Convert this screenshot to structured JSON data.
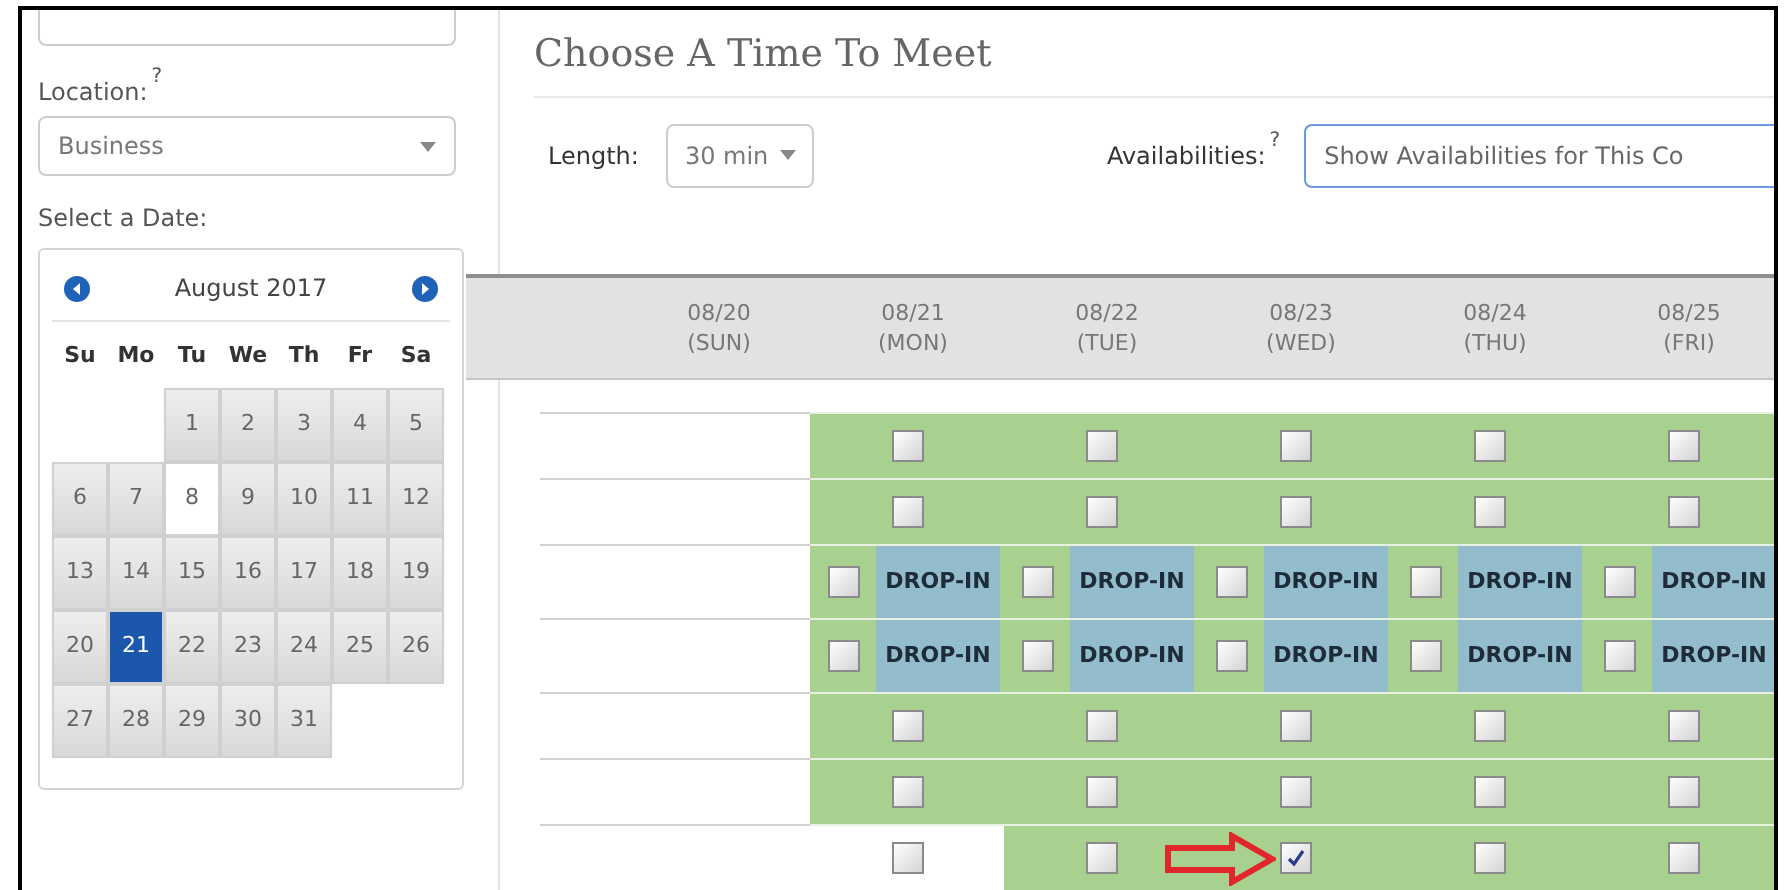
{
  "sidebar": {
    "location": {
      "label": "Location:",
      "hint": "?",
      "value": "Business"
    },
    "date_label": "Select a Date:",
    "calendar": {
      "title": "August 2017",
      "weekdays": [
        "Su",
        "Mo",
        "Tu",
        "We",
        "Th",
        "Fr",
        "Sa"
      ],
      "weeks": [
        [
          {
            "label": "1",
            "today": false,
            "selected": false
          },
          {
            "label": "2",
            "today": false,
            "selected": false
          },
          {
            "label": "3",
            "today": false,
            "selected": false
          },
          {
            "label": "4",
            "today": false,
            "selected": false
          },
          {
            "label": "5",
            "today": false,
            "selected": false
          }
        ],
        [
          {
            "label": "6",
            "today": false,
            "selected": false
          },
          {
            "label": "7",
            "today": false,
            "selected": false
          },
          {
            "label": "8",
            "today": true,
            "selected": false
          },
          {
            "label": "9",
            "today": false,
            "selected": false
          },
          {
            "label": "10",
            "today": false,
            "selected": false
          },
          {
            "label": "11",
            "today": false,
            "selected": false
          },
          {
            "label": "12",
            "today": false,
            "selected": false
          }
        ],
        [
          {
            "label": "13",
            "today": false,
            "selected": false
          },
          {
            "label": "14",
            "today": false,
            "selected": false
          },
          {
            "label": "15",
            "today": false,
            "selected": false
          },
          {
            "label": "16",
            "today": false,
            "selected": false
          },
          {
            "label": "17",
            "today": false,
            "selected": false
          },
          {
            "label": "18",
            "today": false,
            "selected": false
          },
          {
            "label": "19",
            "today": false,
            "selected": false
          }
        ],
        [
          {
            "label": "20",
            "today": false,
            "selected": false
          },
          {
            "label": "21",
            "today": false,
            "selected": true
          },
          {
            "label": "22",
            "today": false,
            "selected": false
          },
          {
            "label": "23",
            "today": false,
            "selected": false
          },
          {
            "label": "24",
            "today": false,
            "selected": false
          },
          {
            "label": "25",
            "today": false,
            "selected": false
          },
          {
            "label": "26",
            "today": false,
            "selected": false
          }
        ],
        [
          {
            "label": "27",
            "today": false,
            "selected": false
          },
          {
            "label": "28",
            "today": false,
            "selected": false
          },
          {
            "label": "29",
            "today": false,
            "selected": false
          },
          {
            "label": "30",
            "today": false,
            "selected": false
          },
          {
            "label": "31",
            "today": false,
            "selected": false
          }
        ]
      ]
    }
  },
  "main": {
    "title": "Choose A Time To Meet",
    "length": {
      "label": "Length:",
      "value": "30 min"
    },
    "availabilities": {
      "label": "Availabilities:",
      "hint": "?",
      "value": "Show Availabilities for This Co"
    },
    "days": [
      {
        "date": "08/20",
        "weekday": "(SUN)"
      },
      {
        "date": "08/21",
        "weekday": "(MON)"
      },
      {
        "date": "08/22",
        "weekday": "(TUE)"
      },
      {
        "date": "08/23",
        "weekday": "(WED)"
      },
      {
        "date": "08/24",
        "weekday": "(THU)"
      },
      {
        "date": "08/25",
        "weekday": "(FRI)"
      }
    ],
    "rows": [
      {
        "kind": "slot",
        "cells": [
          {
            "available": true,
            "checked": false
          },
          {
            "available": true,
            "checked": false
          },
          {
            "available": true,
            "checked": false
          },
          {
            "available": true,
            "checked": false
          },
          {
            "available": true,
            "checked": false
          }
        ]
      },
      {
        "kind": "slot",
        "cells": [
          {
            "available": true,
            "checked": false
          },
          {
            "available": true,
            "checked": false
          },
          {
            "available": true,
            "checked": false
          },
          {
            "available": true,
            "checked": false
          },
          {
            "available": true,
            "checked": false
          }
        ]
      },
      {
        "kind": "drop-in",
        "cells": [
          {
            "available": true,
            "checked": false,
            "tag": "DROP-IN"
          },
          {
            "available": true,
            "checked": false,
            "tag": "DROP-IN"
          },
          {
            "available": true,
            "checked": false,
            "tag": "DROP-IN"
          },
          {
            "available": true,
            "checked": false,
            "tag": "DROP-IN"
          },
          {
            "available": true,
            "checked": false,
            "tag": "DROP-IN"
          }
        ]
      },
      {
        "kind": "drop-in",
        "cells": [
          {
            "available": true,
            "checked": false,
            "tag": "DROP-IN"
          },
          {
            "available": true,
            "checked": false,
            "tag": "DROP-IN"
          },
          {
            "available": true,
            "checked": false,
            "tag": "DROP-IN"
          },
          {
            "available": true,
            "checked": false,
            "tag": "DROP-IN"
          },
          {
            "available": true,
            "checked": false,
            "tag": "DROP-IN"
          }
        ]
      },
      {
        "kind": "slot",
        "cells": [
          {
            "available": true,
            "checked": false
          },
          {
            "available": true,
            "checked": false
          },
          {
            "available": true,
            "checked": false
          },
          {
            "available": true,
            "checked": false
          },
          {
            "available": true,
            "checked": false
          }
        ]
      },
      {
        "kind": "slot",
        "cells": [
          {
            "available": true,
            "checked": false
          },
          {
            "available": true,
            "checked": false
          },
          {
            "available": true,
            "checked": false
          },
          {
            "available": true,
            "checked": false
          },
          {
            "available": true,
            "checked": false
          }
        ]
      },
      {
        "kind": "slot",
        "pointer": true,
        "cells": [
          {
            "available": false,
            "checked": false
          },
          {
            "available": true,
            "checked": false
          },
          {
            "available": true,
            "checked": true
          },
          {
            "available": true,
            "checked": false
          },
          {
            "available": true,
            "checked": false
          }
        ]
      }
    ]
  }
}
